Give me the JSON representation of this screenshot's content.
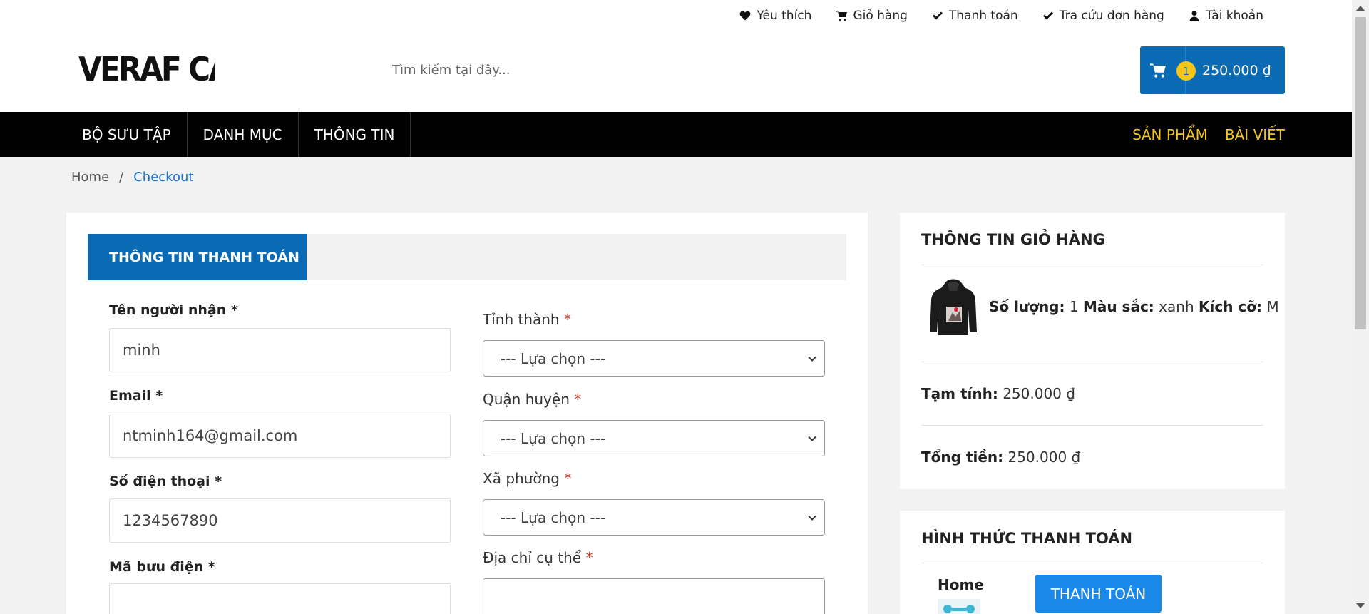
{
  "header": {
    "top_links": [
      {
        "icon": "heart-icon",
        "label": "Yêu thích"
      },
      {
        "icon": "cart-icon",
        "label": "Giỏ hàng"
      },
      {
        "icon": "check-icon",
        "label": "Thanh toán"
      },
      {
        "icon": "check-icon",
        "label": "Tra cứu đơn hàng"
      },
      {
        "icon": "user-icon",
        "label": "Tài khoản"
      }
    ],
    "logo_text": "VERAF CA",
    "search_placeholder": "Tìm kiếm tại đây...",
    "cart": {
      "count": "1",
      "total": "250.000 ₫"
    }
  },
  "nav": {
    "left": [
      "BỘ SƯU TẬP",
      "DANH MỤC",
      "THÔNG TIN"
    ],
    "right": [
      "SẢN PHẨM",
      "BÀI VIẾT"
    ],
    "colors": {
      "background": "#000000",
      "text": "#ffffff",
      "accent": "#f5c518"
    }
  },
  "breadcrumb": {
    "home": "Home",
    "separator": "/",
    "current": "Checkout"
  },
  "checkout": {
    "tab_label": "THÔNG TIN THANH TOÁN",
    "fields_left": [
      {
        "label": "Tên người nhận *",
        "value": "minh"
      },
      {
        "label": "Email *",
        "value": "ntminh164@gmail.com"
      },
      {
        "label": "Số điện thoại *",
        "value": "1234567890"
      },
      {
        "label": "Mã bưu điện *",
        "value": ""
      }
    ],
    "fields_right": [
      {
        "label": "Tỉnh thành",
        "required": "*",
        "value": "--- Lựa chọn ---"
      },
      {
        "label": "Quận huyện",
        "required": "*",
        "value": "--- Lựa chọn ---"
      },
      {
        "label": "Xã phường",
        "required": "*",
        "value": "--- Lựa chọn ---"
      },
      {
        "label": "Địa chỉ cụ thể",
        "required": "*",
        "value": ""
      }
    ]
  },
  "cart_info": {
    "title": "THÔNG TIN GIỎ HÀNG",
    "item": {
      "qty_label": "Số lượng:",
      "qty": "1",
      "color_label": "Màu sắc:",
      "color": "xanh",
      "size_label": "Kích cỡ:",
      "size": "M"
    },
    "subtotal_label": "Tạm tính:",
    "subtotal": "250.000 ₫",
    "total_label": "Tổng tiền:",
    "total": "250.000 ₫"
  },
  "payment": {
    "title": "HÌNH THỨC THANH TOÁN",
    "method_label": "Home",
    "button_label": "THANH TOÁN"
  },
  "brand_colors": {
    "primary": "#0b6ab4",
    "button": "#1a88e8",
    "badge": "#f5c518"
  }
}
